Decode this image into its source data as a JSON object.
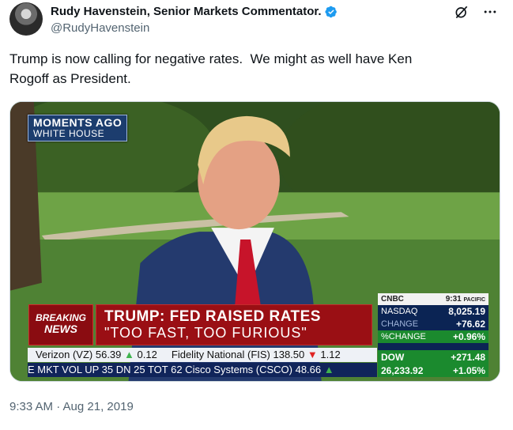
{
  "author": {
    "name": "Rudy Havenstein, Senior Markets Commentator.",
    "handle": "@RudyHavenstein"
  },
  "tweet": {
    "text": "Trump is now calling for negative rates.  We might as well have Ken\nRogoff as President.",
    "timestamp": "9:33 AM · Aug 21, 2019"
  },
  "media": {
    "bug_line1": "MOMENTS AGO",
    "bug_line2": "WHITE HOUSE",
    "breaking_line1": "BREAKING",
    "breaking_line2": "NEWS",
    "headline_line1": "TRUMP: FED RAISED RATES",
    "headline_line2": "\"TOO FAST, TOO FURIOUS\"",
    "ticker1": [
      {
        "text": "Verizon (VZ) 56.39",
        "dir": "up",
        "change": "0.12"
      },
      {
        "text": "Fidelity National (FIS) 138.50",
        "dir": "down",
        "change": "1.12"
      }
    ],
    "ticker2": "E MKT VOL UP  35 DN  25 TOT  62 Cisco Systems (CSCO) 48.66",
    "ticker2_arrow": "▲",
    "market": {
      "network": "CNBC",
      "time": "9:31",
      "zone": "PACIFIC",
      "nasdaq_label": "NASDAQ",
      "nasdaq_value": "8,025.19",
      "change_label": "CHANGE",
      "change_value": "+76.62",
      "pct_label": "%CHANGE",
      "pct_value": "+0.96%",
      "dow_label": "DOW",
      "dow_value": "26,233.92",
      "dow_change": "+271.48",
      "dow_pct": "+1.05%"
    }
  },
  "colors": {
    "verified": "#1d9bf0",
    "handle": "#536471",
    "breaking_red": "#9a0f14"
  },
  "icons": [
    "verified-icon",
    "grok-icon",
    "more-icon",
    "up-arrow-icon",
    "down-arrow-icon"
  ]
}
